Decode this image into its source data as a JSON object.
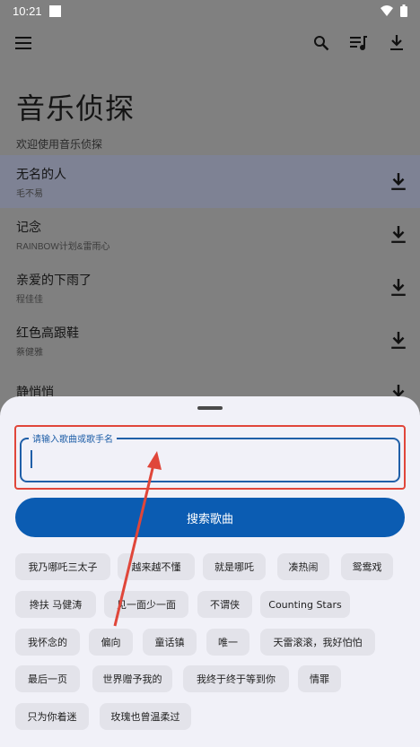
{
  "status_bar": {
    "time": "10:21"
  },
  "hero": {
    "title": "音乐侦探",
    "subtitle": "欢迎使用音乐侦探"
  },
  "songs": [
    {
      "name": "无名的人",
      "artist": "毛不易"
    },
    {
      "name": "记念",
      "artist": "RAINBOW计划&雷雨心"
    },
    {
      "name": "亲爱的下雨了",
      "artist": "程佳佳"
    },
    {
      "name": "红色高跟鞋",
      "artist": "蔡健雅"
    },
    {
      "name": "静悄悄",
      "artist": ""
    }
  ],
  "search": {
    "label": "请输入歌曲或歌手名",
    "value": "",
    "button": "搜索歌曲"
  },
  "suggestions": [
    "我乃哪吒三太子",
    "越来越不懂",
    "就是哪吒",
    "凑热闹",
    "鸳鸯戏",
    "搀扶 马健涛",
    "见一面少一面",
    "不谓侠",
    "Counting Stars",
    "我怀念的",
    "偏向",
    "童话镇",
    "唯一",
    "天雷滚滚，我好怕怕",
    "最后一页",
    "世界赠予我的",
    "我终于终于等到你",
    "情罪",
    "只为你着迷",
    "玫瑰也曾温柔过"
  ],
  "colors": {
    "accent": "#0b5cb2",
    "highlight_box": "#e0463a"
  },
  "icons": [
    "menu-icon",
    "search-icon",
    "playlist-icon",
    "download-icon"
  ]
}
